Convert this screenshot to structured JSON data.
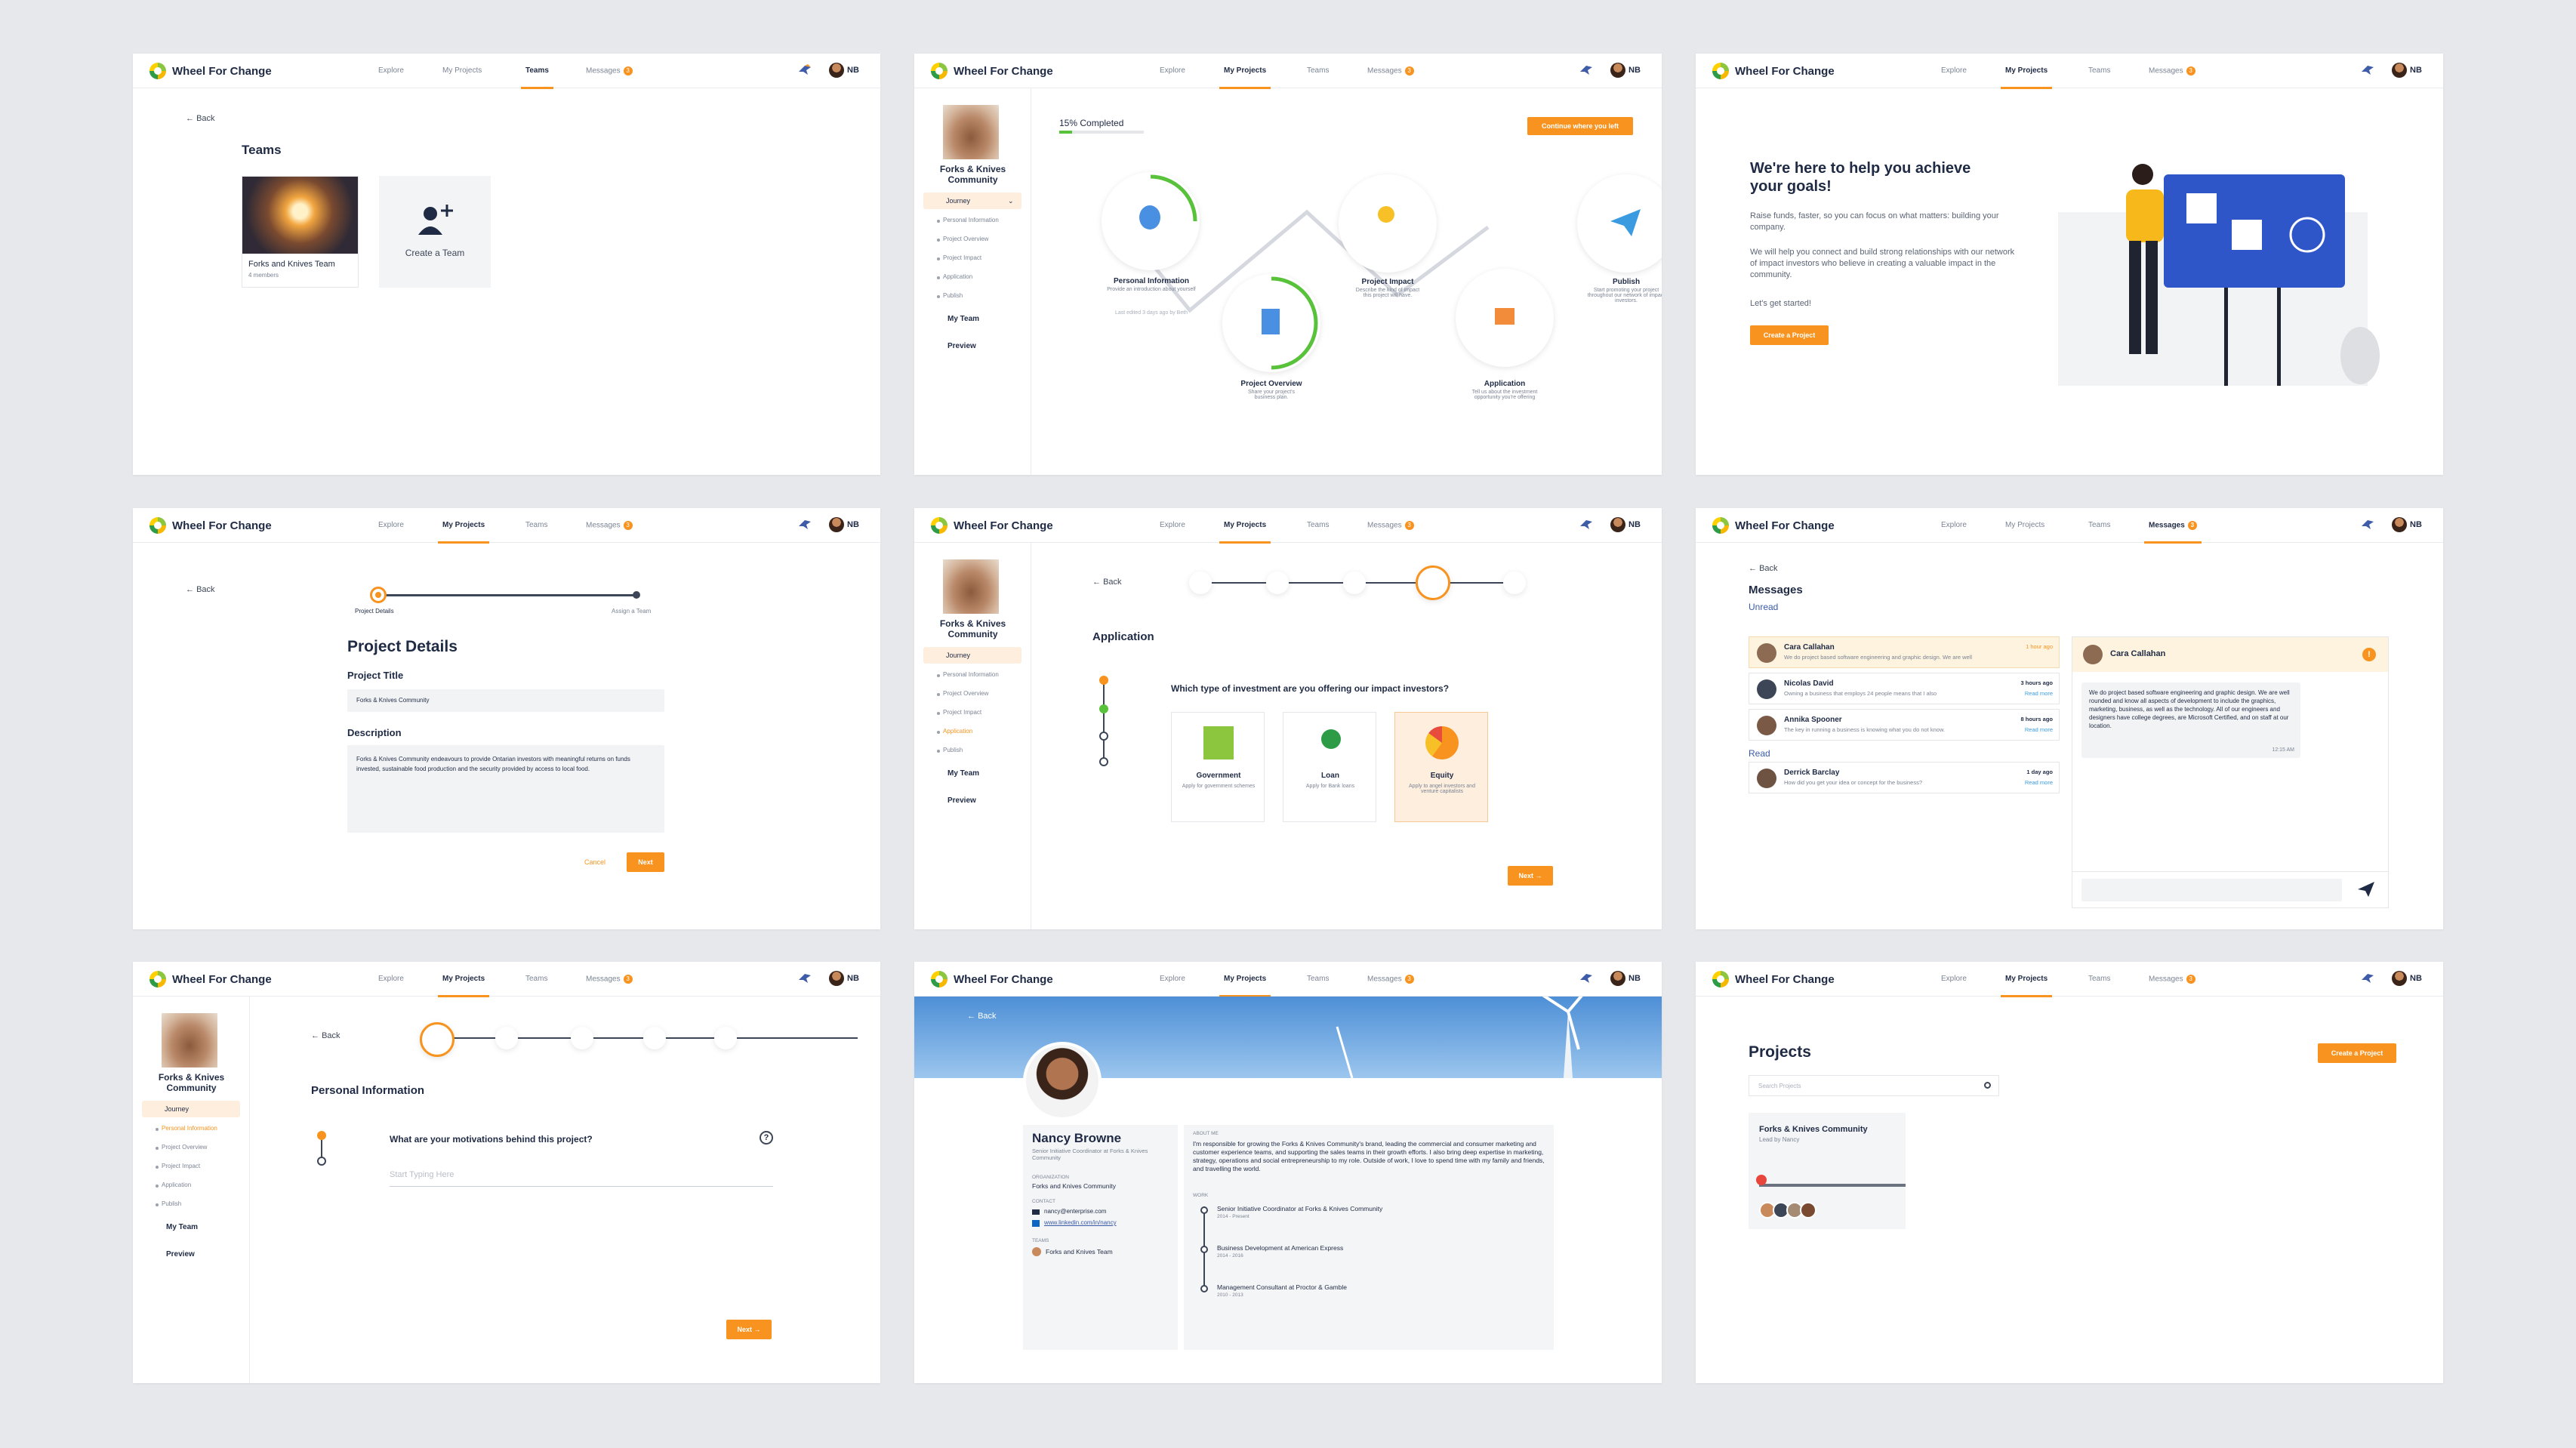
{
  "app": {
    "name": "Wheel For Change",
    "nav": [
      "Explore",
      "My Projects",
      "Teams",
      "Messages"
    ],
    "messages_badge": "3",
    "user_initials": "NB",
    "accent": "#f7931e"
  },
  "common": {
    "back": "Back",
    "project": "Forks & Knives Community",
    "journey": "Journey",
    "steps": [
      "Personal Information",
      "Project Overview",
      "Project Impact",
      "Application",
      "Publish"
    ],
    "my_team": "My Team",
    "preview": "Preview"
  },
  "p1": {
    "title": "Teams",
    "team_name": "Forks and Knives Team",
    "team_members": "4 members",
    "create": "Create a Team"
  },
  "p2": {
    "progress_label": "15% Completed",
    "progress": 0.15,
    "continue": "Continue where you left",
    "nodes": [
      {
        "title": "Personal Information",
        "desc": "Provide an introduction about yourself",
        "meta": "Last edited 3 days ago by Beth"
      },
      {
        "title": "Project Overview",
        "desc": "Share your project's business plan."
      },
      {
        "title": "Project Impact",
        "desc": "Describe the kind of impact this project will have."
      },
      {
        "title": "Application",
        "desc": "Tell us about the investment opportunity you're offering"
      },
      {
        "title": "Publish",
        "desc": "Start promoting your project throughout our network of impact investors."
      }
    ]
  },
  "p3": {
    "heading": "We're here to help you achieve your goals!",
    "p1": "Raise funds, faster, so you can focus on what matters: building your company.",
    "p2": "We will help you connect and build strong relationships with our network of impact investors who believe in creating a valuable impact in the community.",
    "p3": "Let's get started!",
    "cta": "Create a Project"
  },
  "p4": {
    "step1": "Project Details",
    "step2": "Assign a Team",
    "title": "Project Details",
    "l_title": "Project Title",
    "v_title": "Forks & Knives Community",
    "l_desc": "Description",
    "v_desc": "Forks & Knives Community endeavours to provide Ontarian investors with meaningful returns on funds invested, sustainable food production and the security provided by access to local food.",
    "cancel": "Cancel",
    "next": "Next"
  },
  "p5": {
    "title": "Application",
    "question": "Which type of investment are you offering our impact investors?",
    "opts": [
      {
        "t": "Government",
        "d": "Apply for government schemes"
      },
      {
        "t": "Loan",
        "d": "Apply for Bank loans"
      },
      {
        "t": "Equity",
        "d": "Apply to angel investors and venture capitalists"
      }
    ],
    "next": "Next →"
  },
  "p6": {
    "title": "Messages",
    "unread": "Unread",
    "read": "Read",
    "msgs": [
      {
        "n": "Cara Callahan",
        "time": "1 hour ago",
        "text": "We do project based software engineering and graphic design. We are well"
      },
      {
        "n": "Nicolas David",
        "time": "3 hours ago",
        "text": "Owning a business that employs 24 people means that I also",
        "more": "Read more"
      },
      {
        "n": "Annika Spooner",
        "time": "8 hours ago",
        "text": "The key in running a business is knowing what you do not know.",
        "more": "Read more"
      },
      {
        "n": "Derrick Barclay",
        "time": "1 day ago",
        "text": "How did you get your idea or concept for the business?",
        "more": "Read more"
      }
    ],
    "chat_name": "Cara Callahan",
    "chat_text": "We do project based software engineering and graphic design. We are well rounded and know all aspects of development to include the graphics, marketing, business, as well as the technology. All of our engineers and designers have college degrees, are Microsoft Certified, and on staff at our location.",
    "chat_time": "12:15 AM"
  },
  "p7": {
    "title": "Personal Information",
    "question": "What are your motivations behind this project?",
    "placeholder": "Start Typing Here",
    "next": "Next →"
  },
  "p8": {
    "name": "Nancy Browne",
    "role": "Senior Initiative Coordinator at Forks & Knives Community",
    "l_org": "ORGANIZATION",
    "org": "Forks and Knives Community",
    "l_contact": "CONTACT",
    "email": "nancy@enterprise.com",
    "link": "www.linkedin.com/in/nancy",
    "l_teams": "TEAMS",
    "team": "Forks and Knives Team",
    "l_about": "ABOUT ME",
    "about": "I'm responsible for growing the Forks & Knives Community's brand, leading the commercial and consumer marketing and customer experience teams, and supporting the sales teams in their growth efforts. I also bring deep expertise in marketing, strategy, operations and social entrepreneurship to my role. Outside of work, I love to spend time with my family and friends, and travelling the world.",
    "l_work": "WORK",
    "work": [
      {
        "t": "Senior Initiative Coordinator at Forks & Knives Community",
        "d": "2014 - Present"
      },
      {
        "t": "Business Development at American Express",
        "d": "2014 - 2016"
      },
      {
        "t": "Management Consultant at Proctor & Gamble",
        "d": "2010 - 2013"
      }
    ]
  },
  "p9": {
    "title": "Projects",
    "create": "Create a Project",
    "search": "Search Projects",
    "card_title": "Forks & Knives Community",
    "card_lead": "Lead by Nancy"
  }
}
